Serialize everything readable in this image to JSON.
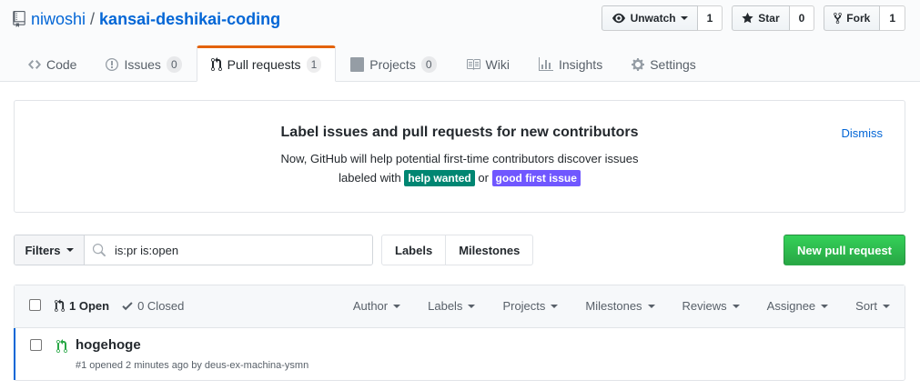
{
  "repo": {
    "owner": "niwoshi",
    "separator": "/",
    "name": "kansai-deshikai-coding"
  },
  "actions": {
    "watch_label": "Unwatch",
    "watch_count": "1",
    "star_label": "Star",
    "star_count": "0",
    "fork_label": "Fork",
    "fork_count": "1"
  },
  "tabs": [
    {
      "label": "Code",
      "icon": "code-icon"
    },
    {
      "label": "Issues",
      "count": "0",
      "icon": "issue-icon"
    },
    {
      "label": "Pull requests",
      "count": "1",
      "icon": "pull-request-icon",
      "selected": true
    },
    {
      "label": "Projects",
      "count": "0",
      "icon": "project-icon"
    },
    {
      "label": "Wiki",
      "icon": "book-icon"
    },
    {
      "label": "Insights",
      "icon": "graph-icon"
    },
    {
      "label": "Settings",
      "icon": "gear-icon"
    }
  ],
  "blankslate": {
    "title": "Label issues and pull requests for new contributors",
    "line1": "Now, GitHub will help potential first-time contributors discover issues",
    "line2_prefix": "labeled with",
    "label1": "help wanted",
    "connector": "or",
    "label2": "good first issue",
    "dismiss": "Dismiss",
    "label1_color": "#008672",
    "label2_color": "#7057ff"
  },
  "subnav": {
    "filters_label": "Filters",
    "search_value": "is:pr is:open",
    "labels_label": "Labels",
    "milestones_label": "Milestones",
    "new_pr_label": "New pull request"
  },
  "list": {
    "open_label": "1 Open",
    "closed_label": "0 Closed",
    "filters": [
      "Author",
      "Labels",
      "Projects",
      "Milestones",
      "Reviews",
      "Assignee",
      "Sort"
    ]
  },
  "pull_requests": [
    {
      "title": "hogehoge",
      "meta": "#1 opened 2 minutes ago by deus-ex-machina-ysmn"
    }
  ],
  "colors": {
    "link": "#0366d6",
    "accent_tab": "#e36209",
    "primary_button": "#28a745",
    "open_pr": "#28a745"
  }
}
